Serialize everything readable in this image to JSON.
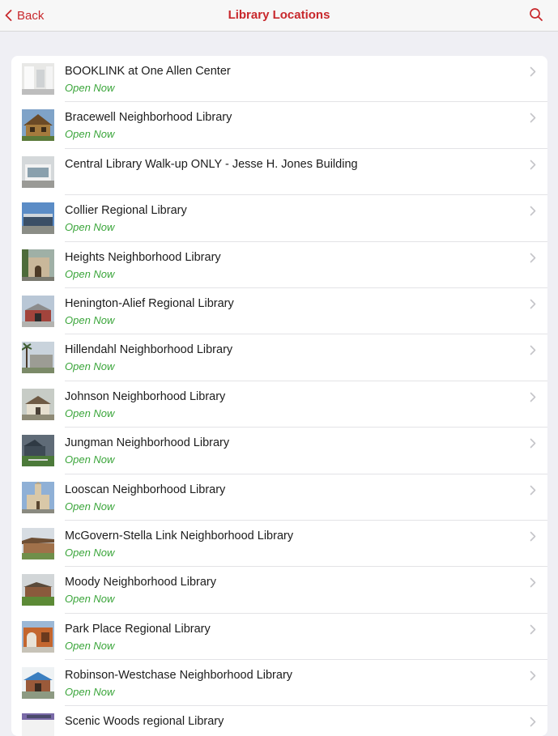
{
  "nav": {
    "back_label": "Back",
    "title": "Library Locations",
    "accent": "#c8282c"
  },
  "status_color": "#3aa53a",
  "locations": [
    {
      "name": "BOOKLINK at One Allen Center",
      "status": "Open Now",
      "thumb": "interior"
    },
    {
      "name": "Bracewell Neighborhood Library",
      "status": "Open Now",
      "thumb": "gable-wood"
    },
    {
      "name": "Central Library Walk-up ONLY - Jesse H. Jones Building",
      "status": "",
      "thumb": "modern-glass"
    },
    {
      "name": "Collier Regional Library",
      "status": "Open Now",
      "thumb": "flat-blue"
    },
    {
      "name": "Heights Neighborhood Library",
      "status": "Open Now",
      "thumb": "historic-arch"
    },
    {
      "name": "Henington-Alief Regional Library",
      "status": "Open Now",
      "thumb": "red-brick"
    },
    {
      "name": "Hillendahl Neighborhood Library",
      "status": "Open Now",
      "thumb": "palm-grey"
    },
    {
      "name": "Johnson Neighborhood Library",
      "status": "Open Now",
      "thumb": "tan-roof"
    },
    {
      "name": "Jungman Neighborhood Library",
      "status": "Open Now",
      "thumb": "dark-lawn"
    },
    {
      "name": "Looscan Neighborhood Library",
      "status": "Open Now",
      "thumb": "church"
    },
    {
      "name": "McGovern-Stella Link Neighborhood Library",
      "status": "Open Now",
      "thumb": "brown-flat"
    },
    {
      "name": "Moody Neighborhood Library",
      "status": "Open Now",
      "thumb": "brick-lawn"
    },
    {
      "name": "Park Place Regional Library",
      "status": "Open Now",
      "thumb": "orange-brick"
    },
    {
      "name": "Robinson-Westchase Neighborhood Library",
      "status": "Open Now",
      "thumb": "blue-gable"
    },
    {
      "name": "Scenic Woods regional Library",
      "status": "",
      "thumb": "sky"
    }
  ]
}
